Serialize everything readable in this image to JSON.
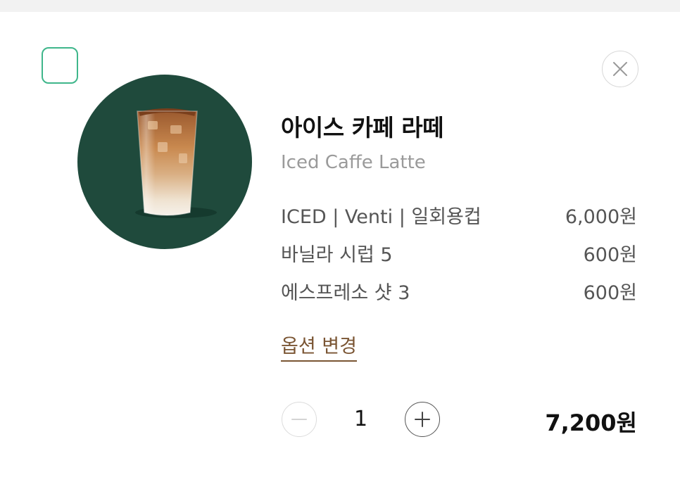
{
  "product": {
    "name_ko": "아이스 카페 라떼",
    "name_en": "Iced Caffe Latte",
    "image_icon": "iced-latte-cup-image",
    "image_bg_color": "#1f4a3c"
  },
  "options": [
    {
      "label": "ICED | Venti | 일회용컵",
      "price": "6,000원"
    },
    {
      "label": "바닐라 시럽 5",
      "price": "600원"
    },
    {
      "label": "에스프레소 샷 3",
      "price": "600원"
    }
  ],
  "change_option_label": "옵션 변경",
  "quantity": "1",
  "total_price": "7,200원",
  "checkbox": {
    "checked": false,
    "border_color": "#3fb68b"
  },
  "icons": {
    "close": "close-icon",
    "minus": "minus-icon",
    "plus": "plus-icon"
  }
}
